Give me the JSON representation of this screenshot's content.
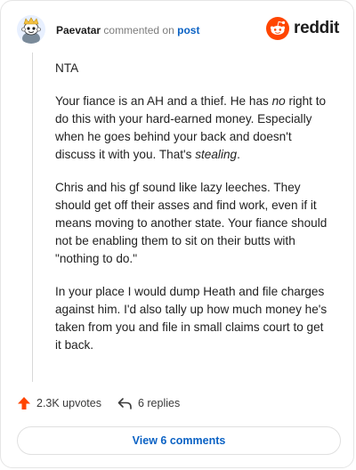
{
  "header": {
    "username": "Paevatar",
    "verb": "commented on",
    "target": "post",
    "brand": "reddit"
  },
  "comment": {
    "p1": "NTA",
    "p2_a": "Your fiance is an AH and a thief. He has ",
    "p2_em": "no",
    "p2_b": " right to do this with your hard-earned money. Especially when he goes behind your back and doesn't discuss it with you. That's ",
    "p2_em2": "stealing",
    "p2_c": ".",
    "p3": "Chris and his gf sound like lazy leeches. They should get off their asses and find work, even if it means moving to another state. Your fiance should not be enabling them to sit on their butts with \"nothing to do.\"",
    "p4": "In your place I would dump Heath and file charges against him. I'd also tally up how much money he's taken from you and file in small claims court to get it back."
  },
  "actions": {
    "upvotes": "2.3K upvotes",
    "replies": "6 replies"
  },
  "footer": {
    "view_comments": "View 6 comments"
  },
  "colors": {
    "accent_blue": "#0b62c4",
    "upvote_orange": "#ff4500",
    "brand_orange": "#ff4500"
  },
  "icons": {
    "avatar": "snoo-avatar",
    "logo": "reddit-snoo-icon",
    "upvote": "upvote-arrow-icon",
    "reply": "reply-arrow-icon"
  }
}
